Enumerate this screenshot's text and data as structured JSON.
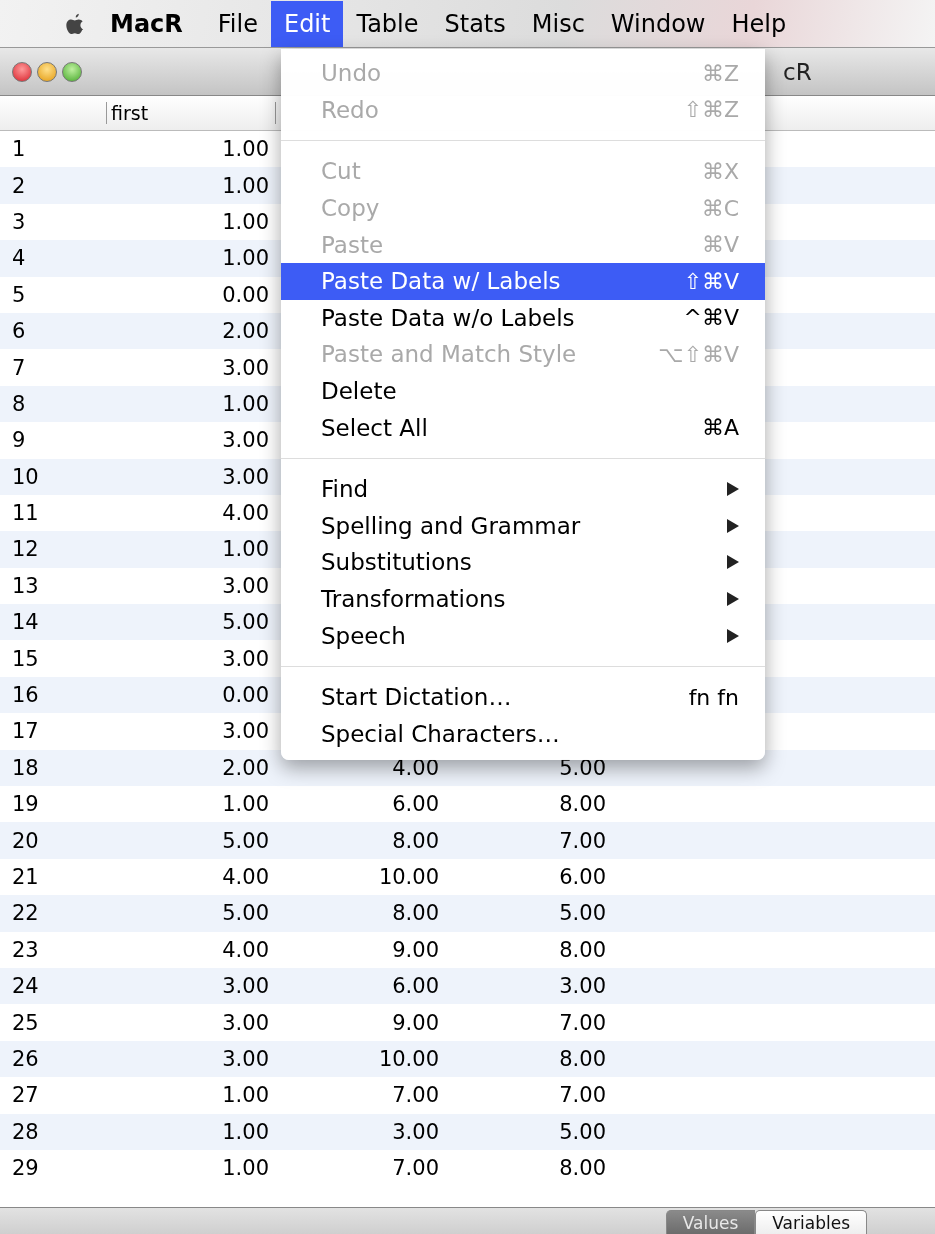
{
  "menubar": {
    "app": "MacR",
    "menus": [
      {
        "label": "File",
        "selected": false
      },
      {
        "label": "Edit",
        "selected": true
      },
      {
        "label": "Table",
        "selected": false
      },
      {
        "label": "Stats",
        "selected": false
      },
      {
        "label": "Misc",
        "selected": false
      },
      {
        "label": "Window",
        "selected": false
      },
      {
        "label": "Help",
        "selected": false
      }
    ]
  },
  "window": {
    "title": "cR"
  },
  "table": {
    "columns": [
      "first"
    ],
    "rows": [
      {
        "number": "1",
        "cells": [
          "1.00"
        ]
      },
      {
        "number": "2",
        "cells": [
          "1.00"
        ]
      },
      {
        "number": "3",
        "cells": [
          "1.00"
        ]
      },
      {
        "number": "4",
        "cells": [
          "1.00"
        ]
      },
      {
        "number": "5",
        "cells": [
          "0.00"
        ]
      },
      {
        "number": "6",
        "cells": [
          "2.00"
        ]
      },
      {
        "number": "7",
        "cells": [
          "3.00"
        ]
      },
      {
        "number": "8",
        "cells": [
          "1.00"
        ]
      },
      {
        "number": "9",
        "cells": [
          "3.00"
        ]
      },
      {
        "number": "10",
        "cells": [
          "3.00"
        ]
      },
      {
        "number": "11",
        "cells": [
          "4.00"
        ]
      },
      {
        "number": "12",
        "cells": [
          "1.00"
        ]
      },
      {
        "number": "13",
        "cells": [
          "3.00"
        ]
      },
      {
        "number": "14",
        "cells": [
          "5.00"
        ]
      },
      {
        "number": "15",
        "cells": [
          "3.00"
        ]
      },
      {
        "number": "16",
        "cells": [
          "0.00"
        ]
      },
      {
        "number": "17",
        "cells": [
          "3.00"
        ]
      },
      {
        "number": "18",
        "cells": [
          "2.00",
          "4.00",
          "5.00"
        ]
      },
      {
        "number": "19",
        "cells": [
          "1.00",
          "6.00",
          "8.00"
        ]
      },
      {
        "number": "20",
        "cells": [
          "5.00",
          "8.00",
          "7.00"
        ]
      },
      {
        "number": "21",
        "cells": [
          "4.00",
          "10.00",
          "6.00"
        ]
      },
      {
        "number": "22",
        "cells": [
          "5.00",
          "8.00",
          "5.00"
        ]
      },
      {
        "number": "23",
        "cells": [
          "4.00",
          "9.00",
          "8.00"
        ]
      },
      {
        "number": "24",
        "cells": [
          "3.00",
          "6.00",
          "3.00"
        ]
      },
      {
        "number": "25",
        "cells": [
          "3.00",
          "9.00",
          "7.00"
        ]
      },
      {
        "number": "26",
        "cells": [
          "3.00",
          "10.00",
          "8.00"
        ]
      },
      {
        "number": "27",
        "cells": [
          "1.00",
          "7.00",
          "7.00"
        ]
      },
      {
        "number": "28",
        "cells": [
          "1.00",
          "3.00",
          "5.00"
        ]
      },
      {
        "number": "29",
        "cells": [
          "1.00",
          "7.00",
          "8.00"
        ]
      }
    ]
  },
  "view_switch": [
    {
      "label": "Values",
      "selected": true
    },
    {
      "label": "Variables",
      "selected": false
    }
  ],
  "edit_menu": [
    {
      "kind": "item",
      "label": "Undo",
      "shortcut": "⌘Z",
      "disabled": true,
      "selected": false,
      "submenu": false
    },
    {
      "kind": "item",
      "label": "Redo",
      "shortcut": "⇧⌘Z",
      "disabled": true,
      "selected": false,
      "submenu": false
    },
    {
      "kind": "separator"
    },
    {
      "kind": "item",
      "label": "Cut",
      "shortcut": "⌘X",
      "disabled": true,
      "selected": false,
      "submenu": false
    },
    {
      "kind": "item",
      "label": "Copy",
      "shortcut": "⌘C",
      "disabled": true,
      "selected": false,
      "submenu": false
    },
    {
      "kind": "item",
      "label": "Paste",
      "shortcut": "⌘V",
      "disabled": true,
      "selected": false,
      "submenu": false
    },
    {
      "kind": "item",
      "label": "Paste Data w/ Labels",
      "shortcut": "⇧⌘V",
      "disabled": false,
      "selected": true,
      "submenu": false
    },
    {
      "kind": "item",
      "label": "Paste Data w/o Labels",
      "shortcut": "^⌘V",
      "disabled": false,
      "selected": false,
      "submenu": false
    },
    {
      "kind": "item",
      "label": "Paste and Match Style",
      "shortcut": "⌥⇧⌘V",
      "disabled": true,
      "selected": false,
      "submenu": false
    },
    {
      "kind": "item",
      "label": "Delete",
      "disabled": false,
      "selected": false,
      "submenu": false
    },
    {
      "kind": "item",
      "label": "Select All",
      "shortcut": "⌘A",
      "disabled": false,
      "selected": false,
      "submenu": false
    },
    {
      "kind": "separator"
    },
    {
      "kind": "item",
      "label": "Find",
      "disabled": false,
      "selected": false,
      "submenu": true
    },
    {
      "kind": "item",
      "label": "Spelling and Grammar",
      "disabled": false,
      "selected": false,
      "submenu": true
    },
    {
      "kind": "item",
      "label": "Substitutions",
      "disabled": false,
      "selected": false,
      "submenu": true
    },
    {
      "kind": "item",
      "label": "Transformations",
      "disabled": false,
      "selected": false,
      "submenu": true
    },
    {
      "kind": "item",
      "label": "Speech",
      "disabled": false,
      "selected": false,
      "submenu": true
    },
    {
      "kind": "separator"
    },
    {
      "kind": "item",
      "label": "Start Dictation…",
      "shortcut": "fn fn",
      "disabled": false,
      "selected": false,
      "submenu": false
    },
    {
      "kind": "item",
      "label": "Special Characters…",
      "disabled": false,
      "selected": false,
      "submenu": false
    }
  ]
}
